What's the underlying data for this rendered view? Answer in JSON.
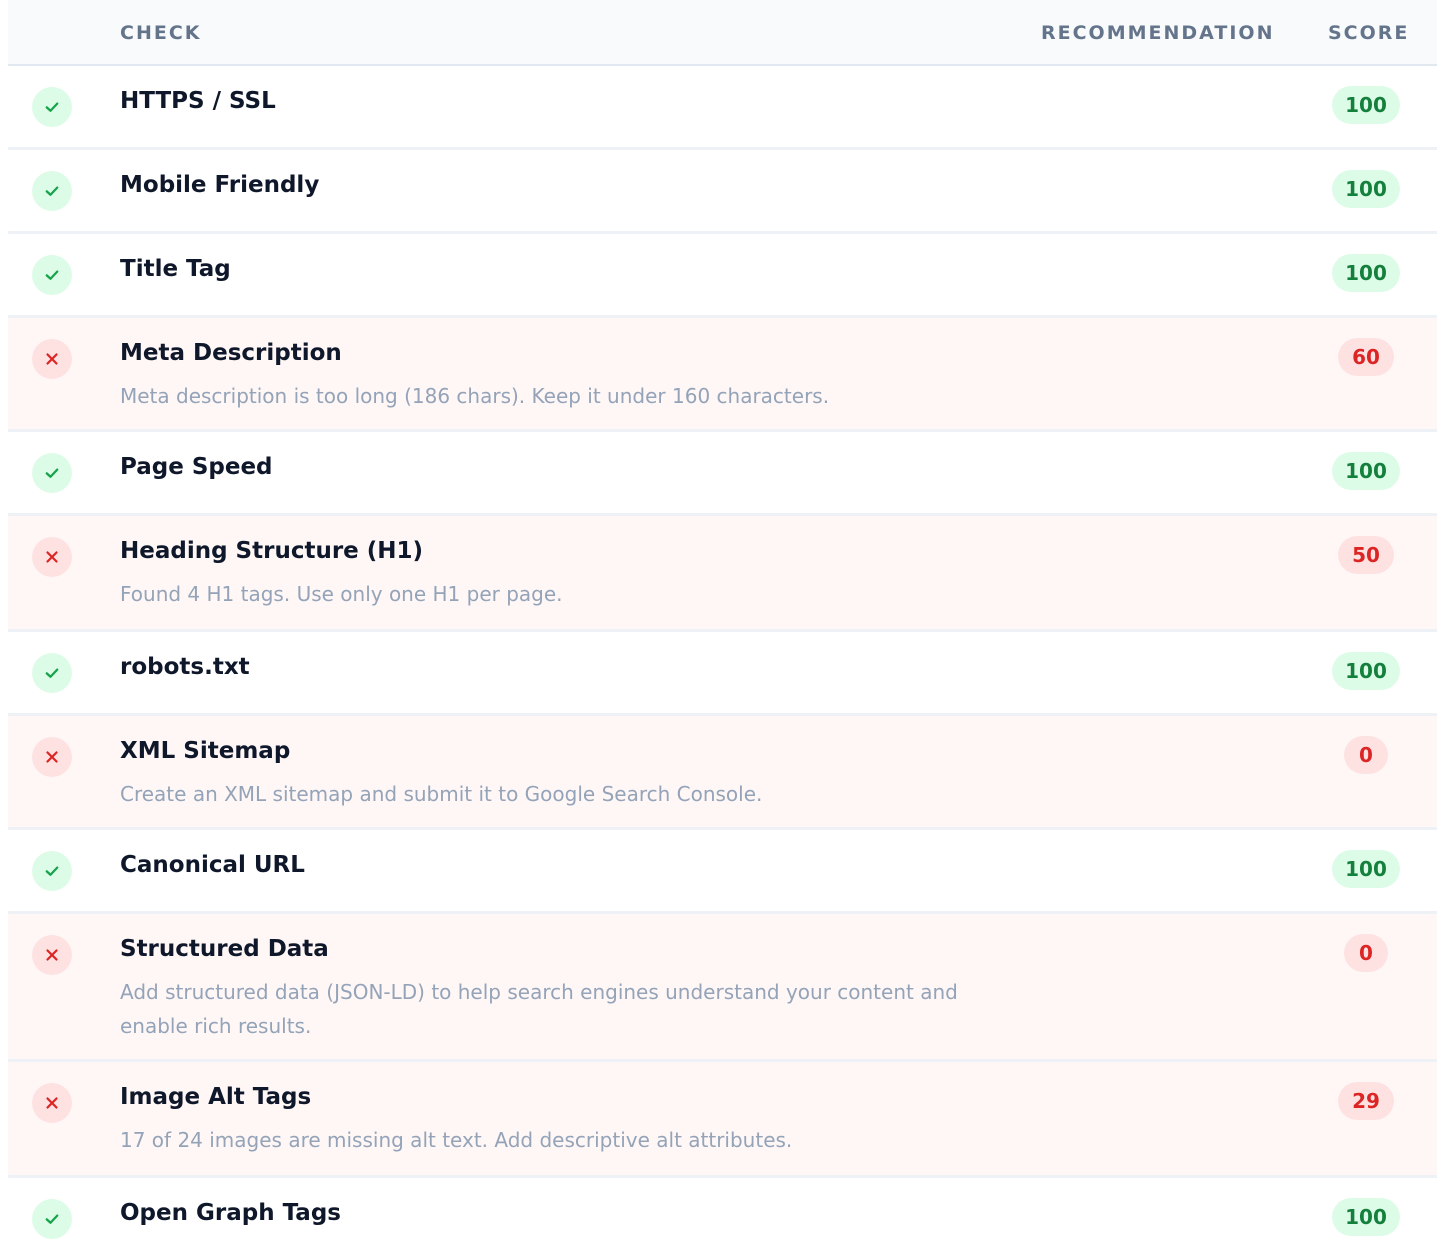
{
  "header": {
    "check": "CHECK",
    "recommendation": "RECOMMENDATION",
    "score": "SCORE"
  },
  "colors": {
    "pass_bg": "#dcfce7",
    "pass_text": "#15803d",
    "fail_bg": "#fee2e2",
    "fail_text": "#dc2626",
    "fail_row_bg": "#fef7f6"
  },
  "rows": [
    {
      "name": "HTTPS / SSL",
      "status": "pass",
      "recommendation": "",
      "score": "100"
    },
    {
      "name": "Mobile Friendly",
      "status": "pass",
      "recommendation": "",
      "score": "100"
    },
    {
      "name": "Title Tag",
      "status": "pass",
      "recommendation": "",
      "score": "100"
    },
    {
      "name": "Meta Description",
      "status": "fail",
      "recommendation": "Meta description is too long (186 chars). Keep it under 160 characters.",
      "score": "60"
    },
    {
      "name": "Page Speed",
      "status": "pass",
      "recommendation": "",
      "score": "100"
    },
    {
      "name": "Heading Structure (H1)",
      "status": "fail",
      "recommendation": "Found 4 H1 tags. Use only one H1 per page.",
      "score": "50"
    },
    {
      "name": "robots.txt",
      "status": "pass",
      "recommendation": "",
      "score": "100"
    },
    {
      "name": "XML Sitemap",
      "status": "fail",
      "recommendation": "Create an XML sitemap and submit it to Google Search Console.",
      "score": "0"
    },
    {
      "name": "Canonical URL",
      "status": "pass",
      "recommendation": "",
      "score": "100"
    },
    {
      "name": "Structured Data",
      "status": "fail",
      "recommendation": "Add structured data (JSON-LD) to help search engines understand your content and enable rich results.",
      "score": "0"
    },
    {
      "name": "Image Alt Tags",
      "status": "fail",
      "recommendation": "17 of 24 images are missing alt text. Add descriptive alt attributes.",
      "score": "29"
    },
    {
      "name": "Open Graph Tags",
      "status": "pass",
      "recommendation": "",
      "score": "100"
    }
  ]
}
